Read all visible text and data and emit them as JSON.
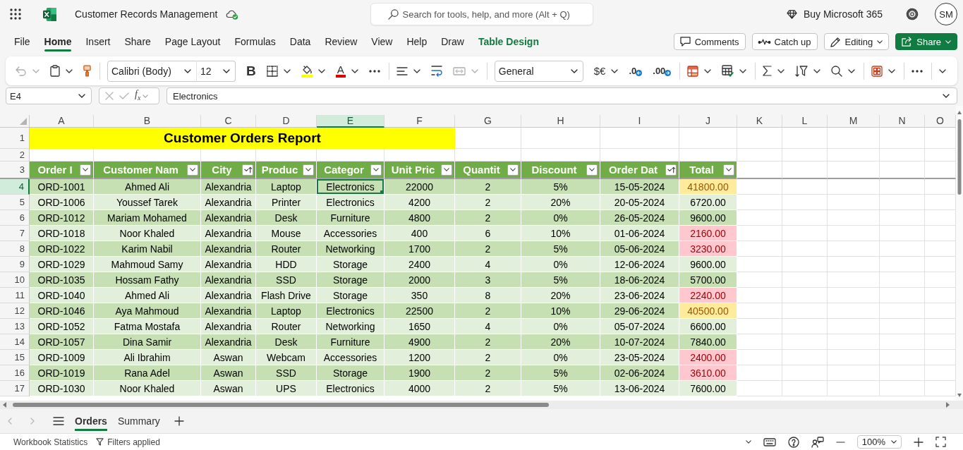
{
  "app_bar": {
    "title": "Customer Records Management",
    "search": {
      "placeholder": "Search for tools, help, and more (Alt + Q)"
    },
    "buy": "Buy Microsoft 365",
    "avatar": "SM"
  },
  "menu_tabs": [
    {
      "label": "File",
      "selected": false,
      "kind": "standard"
    },
    {
      "label": "Home",
      "selected": true,
      "kind": "standard"
    },
    {
      "label": "Insert",
      "selected": false,
      "kind": "standard"
    },
    {
      "label": "Share",
      "selected": false,
      "kind": "standard"
    },
    {
      "label": "Page Layout",
      "selected": false,
      "kind": "standard"
    },
    {
      "label": "Formulas",
      "selected": false,
      "kind": "standard"
    },
    {
      "label": "Data",
      "selected": false,
      "kind": "standard"
    },
    {
      "label": "Review",
      "selected": false,
      "kind": "standard"
    },
    {
      "label": "View",
      "selected": false,
      "kind": "standard"
    },
    {
      "label": "Help",
      "selected": false,
      "kind": "standard"
    },
    {
      "label": "Draw",
      "selected": false,
      "kind": "standard"
    },
    {
      "label": "Table Design",
      "selected": false,
      "kind": "contextual"
    }
  ],
  "actions": [
    {
      "label": "Comments",
      "kind": "outline"
    },
    {
      "label": "Catch up",
      "kind": "outline"
    },
    {
      "label": "Editing",
      "kind": "menu"
    },
    {
      "label": "Share",
      "kind": "primary"
    }
  ],
  "ribbon": [
    {
      "items": [
        {
          "kind": "undo",
          "disabled": true
        },
        {
          "kind": "paste",
          "disabled": false
        },
        {
          "kind": "painter",
          "disabled": false
        }
      ]
    },
    {
      "items": [
        {
          "kind": "font",
          "label": "Calibri (Body)",
          "disabled": false
        },
        {
          "kind": "size",
          "label": "12",
          "disabled": false
        },
        {
          "kind": "bold",
          "label": "B",
          "disabled": false
        },
        {
          "kind": "borders",
          "disabled": false
        },
        {
          "kind": "fill",
          "disabled": false
        },
        {
          "kind": "color",
          "label": "A",
          "disabled": false
        },
        {
          "kind": "more",
          "disabled": false
        }
      ]
    },
    {
      "items": [
        {
          "kind": "align",
          "disabled": false
        },
        {
          "kind": "wrap",
          "disabled": false
        },
        {
          "kind": "merge",
          "disabled": true
        }
      ]
    },
    {
      "items": [
        {
          "kind": "format",
          "label": "General",
          "disabled": false
        },
        {
          "kind": "currency",
          "label": "$€",
          "disabled": false
        },
        {
          "kind": "decrease",
          "label": ".0",
          "disabled": false
        },
        {
          "kind": "increase",
          "label": ".00",
          "disabled": false
        }
      ]
    },
    {
      "items": [
        {
          "kind": "conditional",
          "disabled": false
        },
        {
          "kind": "table",
          "disabled": false
        }
      ]
    },
    {
      "items": [
        {
          "kind": "sum",
          "disabled": false
        },
        {
          "kind": "sort",
          "disabled": false
        },
        {
          "kind": "find",
          "disabled": false
        }
      ]
    },
    {
      "items": [
        {
          "kind": "styles",
          "disabled": false
        }
      ]
    },
    {
      "items": [
        {
          "kind": "more",
          "disabled": false
        }
      ]
    },
    {
      "items": [
        {
          "kind": "collapse",
          "disabled": false
        }
      ]
    }
  ],
  "formula_bar": {
    "name_box": "E4",
    "editing": false,
    "function_symbol": "f$_{x}$",
    "value": "Electronics"
  },
  "sheet": {
    "column_letters": [
      {
        "label": "A",
        "selected": false
      },
      {
        "label": "B",
        "selected": false
      },
      {
        "label": "C",
        "selected": false
      },
      {
        "label": "D",
        "selected": false
      },
      {
        "label": "E",
        "selected": true
      },
      {
        "label": "F",
        "selected": false
      },
      {
        "label": "G",
        "selected": false
      },
      {
        "label": "H",
        "selected": false
      },
      {
        "label": "I",
        "selected": false
      },
      {
        "label": "J",
        "selected": false
      },
      {
        "label": "K",
        "selected": false
      },
      {
        "label": "L",
        "selected": false
      },
      {
        "label": "M",
        "selected": false
      },
      {
        "label": "N",
        "selected": false
      },
      {
        "label": "O",
        "selected": false
      }
    ],
    "row_numbers": [
      {
        "label": "1",
        "selected": false
      },
      {
        "label": "2",
        "selected": false
      },
      {
        "label": "3",
        "selected": false
      },
      {
        "label": "4",
        "selected": true
      },
      {
        "label": "5",
        "selected": false
      },
      {
        "label": "6",
        "selected": false
      },
      {
        "label": "7",
        "selected": false
      },
      {
        "label": "8",
        "selected": false
      },
      {
        "label": "9",
        "selected": false
      },
      {
        "label": "10",
        "selected": false
      },
      {
        "label": "11",
        "selected": false
      },
      {
        "label": "12",
        "selected": false
      },
      {
        "label": "13",
        "selected": false
      },
      {
        "label": "14",
        "selected": false
      },
      {
        "label": "15",
        "selected": false
      },
      {
        "label": "16",
        "selected": false
      },
      {
        "label": "17",
        "selected": false
      }
    ],
    "title": "Customer Orders Report",
    "columns": [
      {
        "label": "Order I",
        "sorted": false
      },
      {
        "label": "Customer Nam",
        "sorted": false
      },
      {
        "label": "City",
        "sorted": true
      },
      {
        "label": "Produc",
        "sorted": false
      },
      {
        "label": "Categor",
        "sorted": false
      },
      {
        "label": "Unit Pric",
        "sorted": false
      },
      {
        "label": "Quantit",
        "sorted": false
      },
      {
        "label": "Discount",
        "sorted": false
      },
      {
        "label": "Order Dat",
        "sorted": true
      },
      {
        "label": "Total",
        "sorted": false
      }
    ],
    "rows": [
      {
        "cells": [
          "ORD-1001",
          "Ahmed Ali",
          "Alexandria",
          "Laptop",
          "Electronics",
          "22000",
          "2",
          "5%",
          "15-05-2024"
        ],
        "total": {
          "value": "41800.00",
          "color": "#ffeb9c"
        }
      },
      {
        "cells": [
          "ORD-1006",
          "Youssef Tarek",
          "Alexandria",
          "Printer",
          "Electronics",
          "4200",
          "2",
          "20%",
          "20-05-2024"
        ],
        "total": {
          "value": "6720.00"
        }
      },
      {
        "cells": [
          "ORD-1012",
          "Mariam Mohamed",
          "Alexandria",
          "Desk",
          "Furniture",
          "4800",
          "2",
          "0%",
          "26-05-2024"
        ],
        "total": {
          "value": "9600.00"
        }
      },
      {
        "cells": [
          "ORD-1018",
          "Noor Khaled",
          "Alexandria",
          "Mouse",
          "Accessories",
          "400",
          "6",
          "10%",
          "01-06-2024"
        ],
        "total": {
          "value": "2160.00",
          "color": "#ffc7ce"
        }
      },
      {
        "cells": [
          "ORD-1022",
          "Karim Nabil",
          "Alexandria",
          "Router",
          "Networking",
          "1700",
          "2",
          "5%",
          "05-06-2024"
        ],
        "total": {
          "value": "3230.00",
          "color": "#ffc7ce"
        }
      },
      {
        "cells": [
          "ORD-1029",
          "Mahmoud Samy",
          "Alexandria",
          "HDD",
          "Storage",
          "2400",
          "4",
          "0%",
          "12-06-2024"
        ],
        "total": {
          "value": "9600.00"
        }
      },
      {
        "cells": [
          "ORD-1035",
          "Hossam Fathy",
          "Alexandria",
          "SSD",
          "Storage",
          "2000",
          "3",
          "5%",
          "18-06-2024"
        ],
        "total": {
          "value": "5700.00"
        }
      },
      {
        "cells": [
          "ORD-1040",
          "Ahmed Ali",
          "Alexandria",
          "Flash Drive",
          "Storage",
          "350",
          "8",
          "20%",
          "23-06-2024"
        ],
        "total": {
          "value": "2240.00",
          "color": "#ffc7ce"
        }
      },
      {
        "cells": [
          "ORD-1046",
          "Aya Mahmoud",
          "Alexandria",
          "Laptop",
          "Electronics",
          "22500",
          "2",
          "10%",
          "29-06-2024"
        ],
        "total": {
          "value": "40500.00",
          "color": "#ffeb9c"
        }
      },
      {
        "cells": [
          "ORD-1052",
          "Fatma Mostafa",
          "Alexandria",
          "Router",
          "Networking",
          "1650",
          "4",
          "0%",
          "05-07-2024"
        ],
        "total": {
          "value": "6600.00"
        }
      },
      {
        "cells": [
          "ORD-1057",
          "Dina Samir",
          "Alexandria",
          "Desk",
          "Furniture",
          "4900",
          "2",
          "20%",
          "10-07-2024"
        ],
        "total": {
          "value": "7840.00"
        }
      },
      {
        "cells": [
          "ORD-1009",
          "Ali Ibrahim",
          "Aswan",
          "Webcam",
          "Accessories",
          "1200",
          "2",
          "0%",
          "23-05-2024"
        ],
        "total": {
          "value": "2400.00",
          "color": "#ffc7ce"
        }
      },
      {
        "cells": [
          "ORD-1019",
          "Rana Adel",
          "Aswan",
          "SSD",
          "Storage",
          "1900",
          "2",
          "5%",
          "02-06-2024"
        ],
        "total": {
          "value": "3610.00",
          "color": "#ffc7ce"
        }
      },
      {
        "cells": [
          "ORD-1030",
          "Noor Khaled",
          "Aswan",
          "UPS",
          "Electronics",
          "4000",
          "2",
          "5%",
          "13-06-2024"
        ],
        "total": {
          "value": "7600.00"
        }
      }
    ]
  },
  "sheet_tabs": [
    {
      "label": "Orders",
      "selected": true
    },
    {
      "label": "Summary",
      "selected": false
    }
  ],
  "status_bar": {
    "items": [
      {
        "label": "Workbook Statistics",
        "kind": "plain"
      },
      {
        "label": "Filters applied",
        "kind": "filter"
      }
    ],
    "zoom": "100%"
  }
}
